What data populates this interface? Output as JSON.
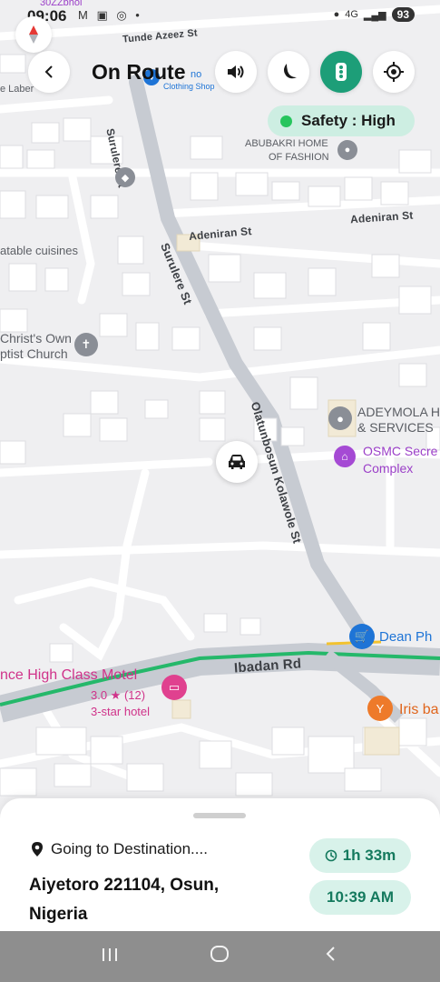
{
  "status_bar": {
    "time": "09:06",
    "notif_icons": "M ▣ ◎ •",
    "network": "4G",
    "battery": "93"
  },
  "header": {
    "title": "On Route"
  },
  "safety": {
    "label": "Safety : High",
    "dot_color": "#26c55d"
  },
  "map": {
    "streets": {
      "tunde_azeez": "Tunde Azeez St",
      "surulere_top": "Surulere St",
      "surulere_mid": "Surulere St",
      "adeniran_left": "Adeniran St",
      "adeniran_right": "Adeniran St",
      "olatunbosun": "Olatunbosun Kolawole St",
      "ibadan_rd": "Ibadan Rd"
    },
    "places": {
      "top_user": "30ZZbhoi",
      "laber": "e Laber",
      "clothing_partial": "no",
      "clothing_shop": "Clothing Shop",
      "abubakri": "ABUBAKRI HOME",
      "abubakri_2": "OF FASHION",
      "cuisines": "atable cuisines",
      "christ_own": "Christ's Own",
      "baptist": "ptist Church",
      "adeyemola": "ADEYMOLA H",
      "adeyemola_2": "& SERVICES",
      "osmc": "OSMC Secre",
      "osmc_2": "Complex",
      "dean": "Dean Ph",
      "motel": "nce High Class Motel",
      "motel_rating": "3.0 ★ (12)",
      "motel_class": "3-star hotel",
      "iris": "Iris ba"
    }
  },
  "sheet": {
    "status": "Going to Destination....",
    "destination": "Aiyetoro 221104, Osun, Nigeria",
    "duration": "1h 33m",
    "eta": "10:39 AM"
  },
  "colors": {
    "accent": "#1d9e78",
    "route": "#25b86a",
    "pill_bg": "#d8f2ea"
  }
}
